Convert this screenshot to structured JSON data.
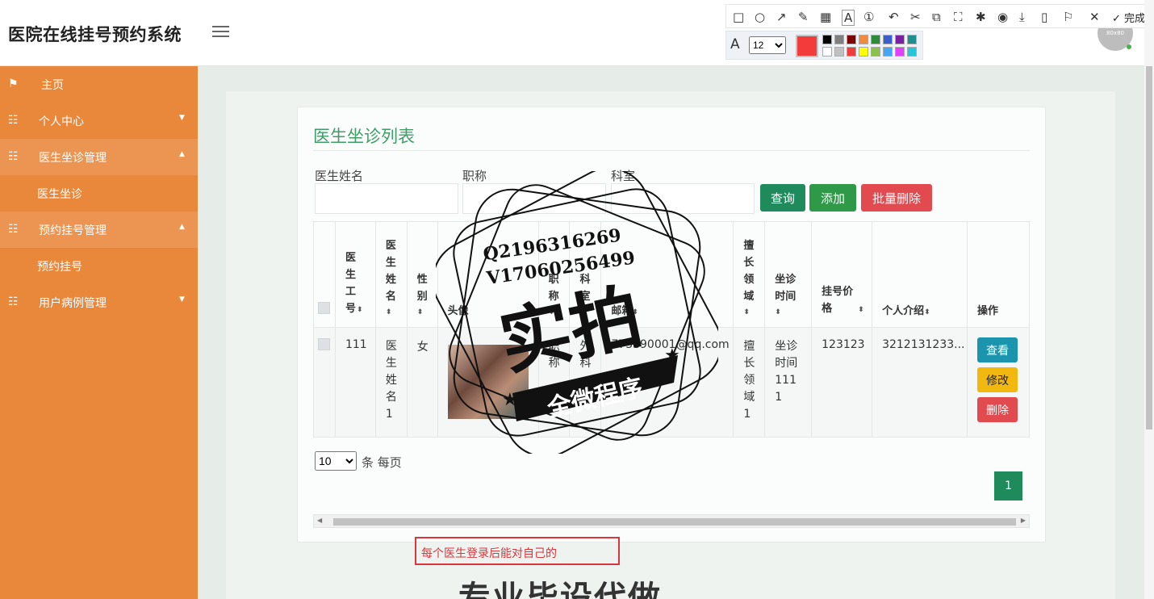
{
  "header": {
    "title": "医院在线挂号预约系统",
    "avatar_text": "80x80"
  },
  "sidebar": {
    "items": [
      {
        "label": "主页"
      },
      {
        "label": "个人中心"
      },
      {
        "label": "医生坐诊管理"
      },
      {
        "label": "医生坐诊"
      },
      {
        "label": "预约挂号管理"
      },
      {
        "label": "预约挂号"
      },
      {
        "label": "用户病例管理"
      }
    ]
  },
  "page": {
    "title": "医生坐诊列表",
    "filters": {
      "name_label": "医生姓名",
      "title_label": "职称",
      "dept_label": "科室"
    },
    "buttons": {
      "query": "查询",
      "add": "添加",
      "batch_delete": "批量删除"
    }
  },
  "table": {
    "columns": [
      "医生工号",
      "医生姓名",
      "性别",
      "头像",
      "职称",
      "科室",
      "邮箱",
      "擅长领域",
      "坐诊时间",
      "挂号价格",
      "个人介绍",
      "操作"
    ],
    "rows": [
      {
        "id": "111",
        "name": "医生姓名1",
        "gender": "女",
        "title": "职称",
        "dept": "外科",
        "email": "773890001@qq.com",
        "specialty": "擅长领域1",
        "time": "坐诊时间1111",
        "price": "123123",
        "intro": "3212131233...",
        "actions": {
          "view": "查看",
          "edit": "修改",
          "delete": "删除"
        }
      }
    ]
  },
  "pagination": {
    "page_size": "10",
    "page_size_label": "条 每页",
    "current_page": "1"
  },
  "annotation_text": "每个医生登录后能对自己的",
  "watermark": {
    "line1": "Q2196316269",
    "line2": "V17060256499",
    "big": "实拍",
    "banner": "全微程序",
    "bottom": "专业毕设代做"
  },
  "toolbar": {
    "done_label": "完成",
    "font_size": "12",
    "current_color": "#f23b3b",
    "swatches": [
      "#000000",
      "#808080",
      "#800000",
      "#f08a3c",
      "#2e8b3a",
      "#3a5fcd",
      "#7b1fa2",
      "#1e8f8f",
      "#ffffff",
      "#c0c0c0",
      "#f23b3b",
      "#ffff00",
      "#8bc34a",
      "#42a5f5",
      "#e040fb",
      "#26c6da"
    ]
  },
  "colors": {
    "sidebar": "#e9883b",
    "accent_green": "#3f9d67",
    "danger": "#e14b50"
  }
}
